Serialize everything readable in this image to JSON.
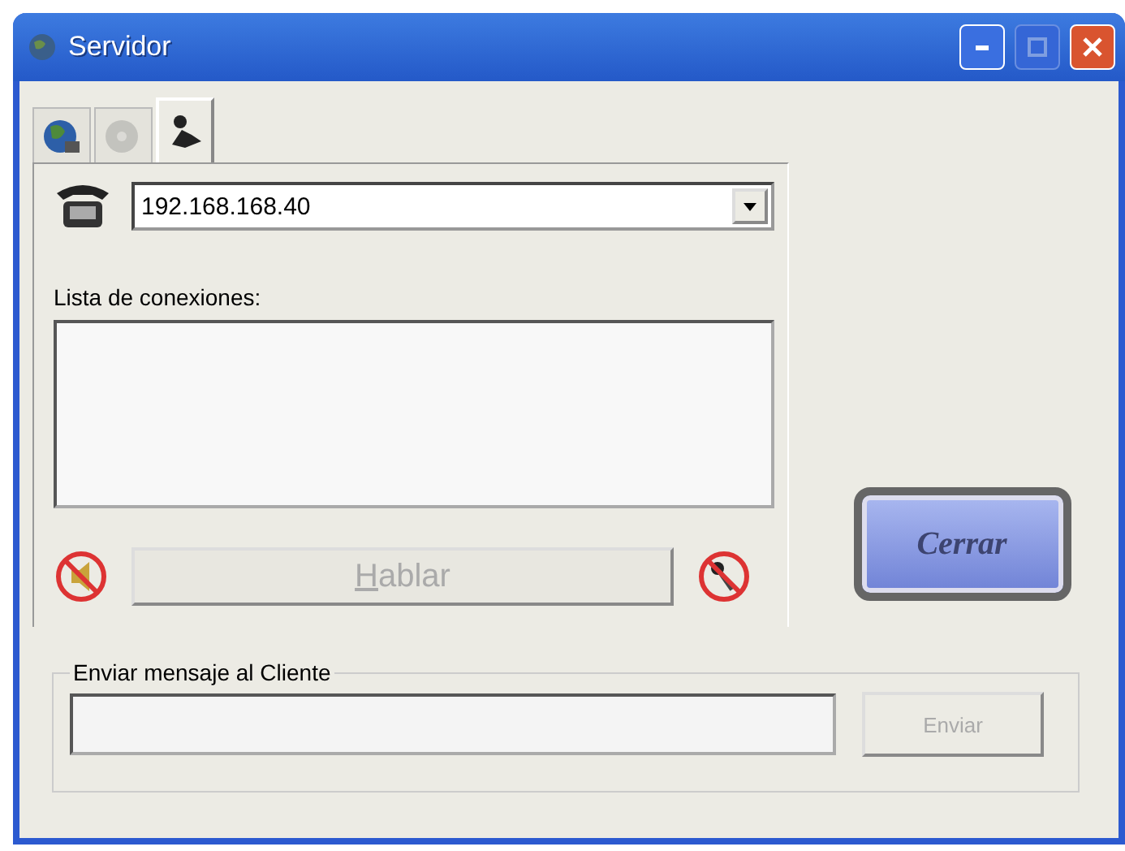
{
  "window": {
    "title": "Servidor"
  },
  "tabs": [
    {
      "kind": "globe",
      "selected": false,
      "disabled": false
    },
    {
      "kind": "disc",
      "selected": false,
      "disabled": true
    },
    {
      "kind": "user",
      "selected": true,
      "disabled": false
    }
  ],
  "address": {
    "value": "192.168.168.40"
  },
  "connections": {
    "label": "Lista de conexiones:"
  },
  "talk_button": {
    "label": "Hablar",
    "disabled": true
  },
  "close_button": {
    "label": "Cerrar"
  },
  "message_group": {
    "title": "Enviar mensaje al Cliente",
    "send_button": {
      "label": "Enviar",
      "disabled": true
    }
  }
}
